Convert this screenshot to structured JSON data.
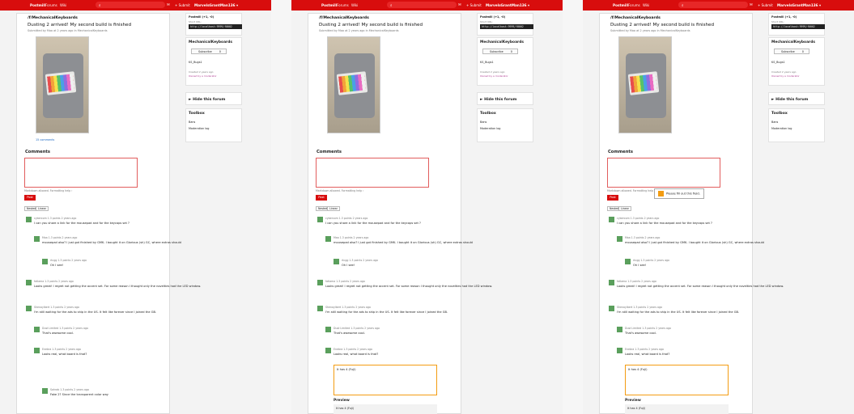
{
  "topbar": {
    "brand": "Postmill",
    "forums": "Forums",
    "wiki": "Wiki",
    "submit": "+ Submit",
    "user": "MarvelsGrantMan136 ▾"
  },
  "post": {
    "forum": "/f/MechanicalKeyboards",
    "title": "Dusting 2 arrived! My second build is finished ",
    "byline": "Submitted by Maa at 2 years ago in MechanicalKeyboards",
    "comments_link": "15 comments"
  },
  "comments": {
    "heading": "Comments",
    "markdown_note": "Markdown allowed. Formatting help ›",
    "post_button": "Post",
    "sort": [
      "Nested",
      "Linear"
    ],
    "items": [
      {
        "meta": "cybercom 1.3 points 2 years ago",
        "text": "I can you share a link for the mousepad and for the keycaps set ?"
      },
      {
        "meta": "Maa 1.3 points 2 years ago",
        "text": "mousepad also? I just got finished by GMK. I bought it on Glorious (sh) GC, where extras should"
      },
      {
        "meta": "rtcgg 1.3 points 2 years ago",
        "text": "Oh I see!"
      },
      {
        "meta": "fatlama 1.3 points 2 years ago",
        "text": "Looks great! I regret not getting the accent set. For some reason I thought only the novelties had the LED window."
      },
      {
        "meta": "Shenaylbert 1.3 points 2 years ago",
        "text": "I'm still waiting for the ads to ship in the US. It felt like forever since I joined the GB."
      },
      {
        "meta": "Dust Limited 1.3 points 2 years ago",
        "text": "That's awesome cool."
      },
      {
        "meta": "Enebra 1.3 points 2 years ago",
        "text": "Looks real, what board is that?"
      },
      {
        "meta": "Sohrab 1.3 points 2 years ago",
        "text": "Fake 2? Since the transparent color way"
      }
    ]
  },
  "sidebar": {
    "info_title": "Postmill (+1, -0)",
    "info_sub": "Short URL:",
    "url": "http://localhost:9999/f0002",
    "forum_name": "MechanicalKeyboards",
    "subscribe_label": "Subscribe",
    "subscribe_count": "0",
    "owner": "KS_Bugs1",
    "created": "Created 2 years ago",
    "created_by": "Owned by a moderator",
    "hide_forum": "► Hide this forum",
    "toolbox": "Toolbox",
    "tool_bans": "Bans",
    "tool_modlog": "Moderation log"
  },
  "validation": {
    "tooltip": "Please fill out this field."
  },
  "editor": {
    "content": "It has 4 (Fuji)",
    "preview_heading": "Preview",
    "preview_content": "It has 4 (Fuji)"
  }
}
